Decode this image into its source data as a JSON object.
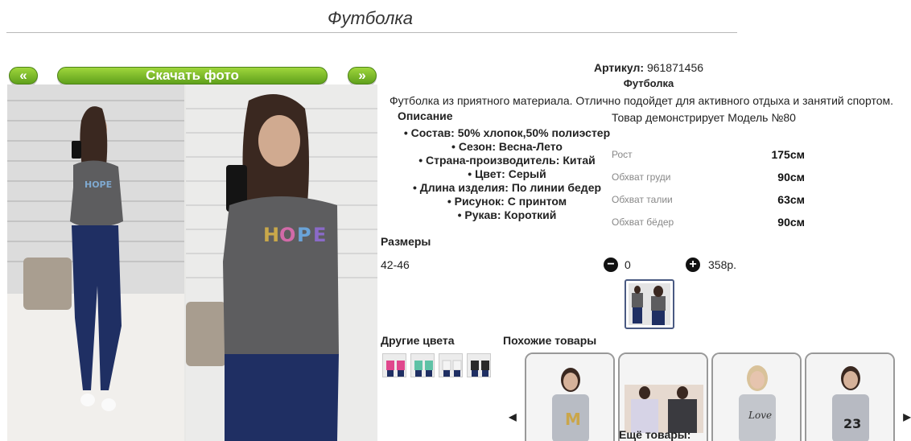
{
  "title": "Футболка",
  "gallery": {
    "prev_label": "«",
    "next_label": "»",
    "download_label": "Скачать фото"
  },
  "product": {
    "sku_label": "Артикул:",
    "sku": "961871456",
    "name": "Футболка",
    "description": "Футболка из приятного материала. Отлично подойдет для активного отдыха и занятий спортом.",
    "properties_title": "Описание",
    "properties": [
      "Состав: 50% хлопок,50% полиэстер",
      "Сезон: Весна-Лето",
      "Страна-производитель: Китай",
      "Цвет: Серый",
      "Длина изделия: По линии бедер",
      "Рисунок: С принтом",
      "Рукав: Короткий"
    ]
  },
  "model": {
    "title": "Товар демонстрирует Модель №80",
    "measures": [
      {
        "label": "Рост",
        "value": "175см"
      },
      {
        "label": "Обхват груди",
        "value": "90см"
      },
      {
        "label": "Обхват талии",
        "value": "63см"
      },
      {
        "label": "Обхват бёдер",
        "value": "90см"
      }
    ]
  },
  "sizes": {
    "title": "Размеры",
    "size": "42-46",
    "quantity": "0",
    "price": "358р."
  },
  "other_colors": {
    "title": "Другие цвета",
    "colors": [
      "#e0478d",
      "#5fc2a6",
      "#f4f4f4",
      "#2a2a2a"
    ]
  },
  "similar": {
    "title": "Похожие товары",
    "more_label": "Ещё товары:"
  },
  "colors": {
    "accent_green": "#6fb52a",
    "shirt_gray": "#5d5d5f",
    "jeans_blue": "#1f2f63"
  }
}
